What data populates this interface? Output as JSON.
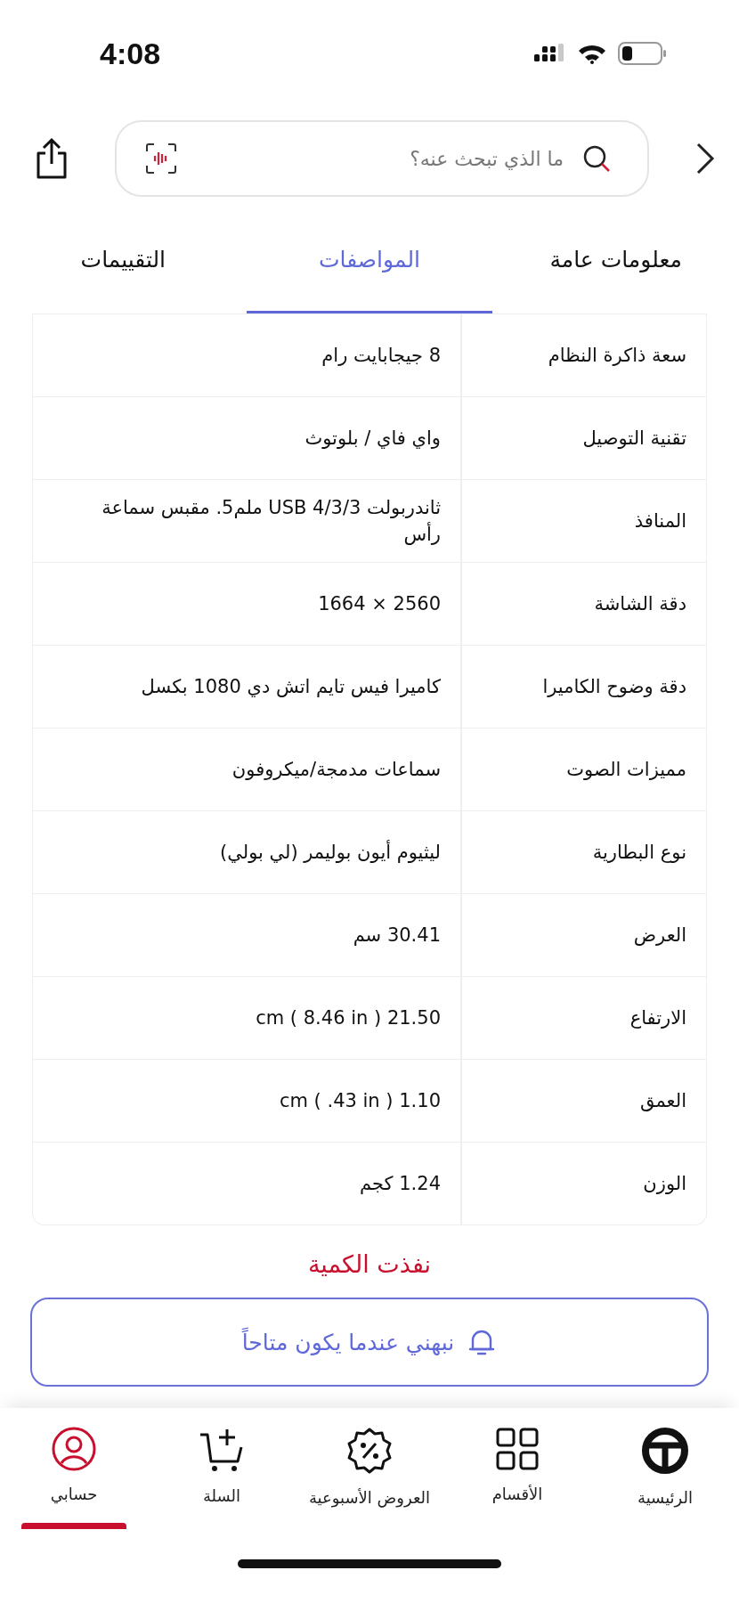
{
  "status_bar": {
    "time": "4:08"
  },
  "search": {
    "placeholder": "ما الذي تبحث عنه؟"
  },
  "tabs": [
    {
      "label": "معلومات عامة",
      "selected": false
    },
    {
      "label": "المواصفات",
      "selected": true
    },
    {
      "label": "التقييمات",
      "selected": false
    }
  ],
  "specs": [
    {
      "name": "سعة ذاكرة النظام",
      "value": "8 جيجابايت رام"
    },
    {
      "name": "تقنية التوصيل",
      "value": "واي فاي / بلوتوث"
    },
    {
      "name": "المنافذ",
      "value": "ثاندربولت 3/USB 4/3 ملم5. مقبس سماعة رأس"
    },
    {
      "name": "دقة الشاشة",
      "value": "2560 × 1664"
    },
    {
      "name": "دقة وضوح الكاميرا",
      "value": "كاميرا فيس تايم اتش دي 1080 بكسل"
    },
    {
      "name": "مميزات الصوت",
      "value": "سماعات مدمجة/ميكروفون"
    },
    {
      "name": "نوع البطارية",
      "value": "ليثيوم أيون بوليمر (لي بولي)"
    },
    {
      "name": "العرض",
      "value": "30.41 سم"
    },
    {
      "name": "الارتفاع",
      "value": "21.50 cm ( 8.46 in )"
    },
    {
      "name": "العمق",
      "value": "1.10 cm ( .43 in )"
    },
    {
      "name": "الوزن",
      "value": "1.24 كجم"
    }
  ],
  "stock_status": "نفذت الكمية",
  "notify_button": "نبهني عندما يكون متاحاً",
  "nav": [
    {
      "kind": "home",
      "label": "الرئيسية",
      "selected": false
    },
    {
      "kind": "categories",
      "label": "الأقسام",
      "selected": false
    },
    {
      "kind": "offers",
      "label": "العروض الأسبوعية",
      "selected": false
    },
    {
      "kind": "cart",
      "label": "السلة",
      "selected": false
    },
    {
      "kind": "account",
      "label": "حسابي",
      "selected": true
    }
  ]
}
